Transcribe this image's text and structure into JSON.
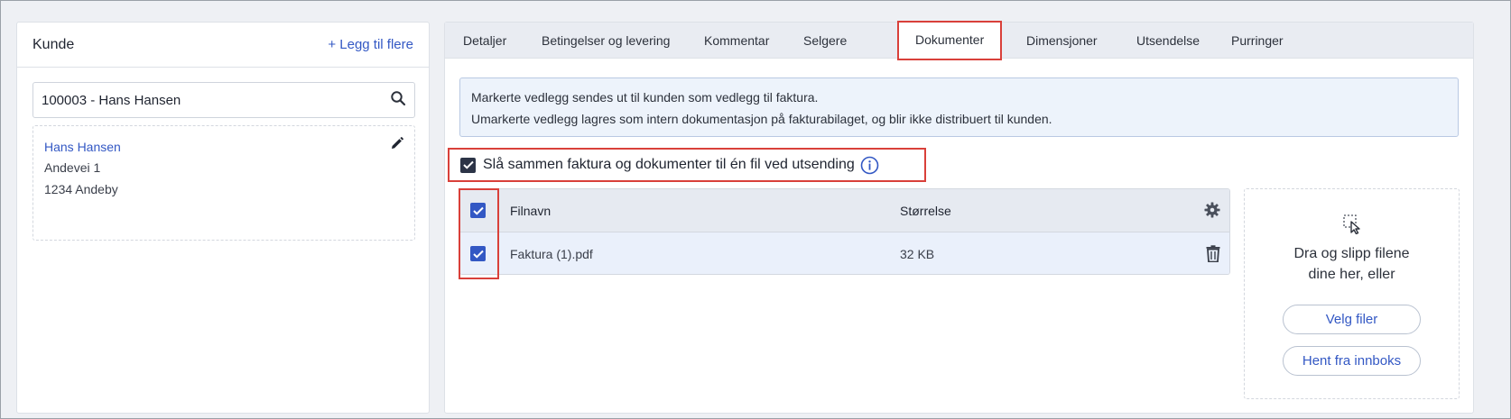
{
  "customer": {
    "title": "Kunde",
    "add_more_label": "+ Legg til flere",
    "search_value": "100003 - Hans Hansen",
    "card": {
      "name": "Hans Hansen",
      "address_line1": "Andevei 1",
      "address_line2": "1234 Andeby"
    }
  },
  "tabs": [
    {
      "label": "Detaljer"
    },
    {
      "label": "Betingelser og levering"
    },
    {
      "label": "Kommentar"
    },
    {
      "label": "Selgere"
    },
    {
      "label": "Dokumenter",
      "active": true
    },
    {
      "label": "Dimensjoner"
    },
    {
      "label": "Utsendelse"
    },
    {
      "label": "Purringer"
    }
  ],
  "info": {
    "line1": "Markerte vedlegg sendes ut til kunden som vedlegg til faktura.",
    "line2": "Umarkerte vedlegg lagres som intern dokumentasjon på fakturabilaget, og blir ikke distribuert til kunden."
  },
  "merge_option": {
    "label": "Slå sammen faktura og dokumenter til én fil ved utsending",
    "checked": true
  },
  "file_table": {
    "columns": {
      "name": "Filnavn",
      "size": "Størrelse"
    },
    "rows": [
      {
        "name": "Faktura (1).pdf",
        "size": "32 KB",
        "checked": true
      }
    ]
  },
  "dropzone": {
    "text_line1": "Dra og slipp filene",
    "text_line2": "dine her, eller",
    "select_files_label": "Velg filer",
    "fetch_inbox_label": "Hent fra innboks"
  },
  "colors": {
    "accent": "#3358c4",
    "highlight": "#d9403a",
    "checkbox_dark": "#2c3447"
  },
  "icons": [
    "search-icon",
    "pencil-icon",
    "info-icon",
    "checkmark-icon",
    "gear-icon",
    "trash-icon",
    "select-cursor-icon"
  ]
}
